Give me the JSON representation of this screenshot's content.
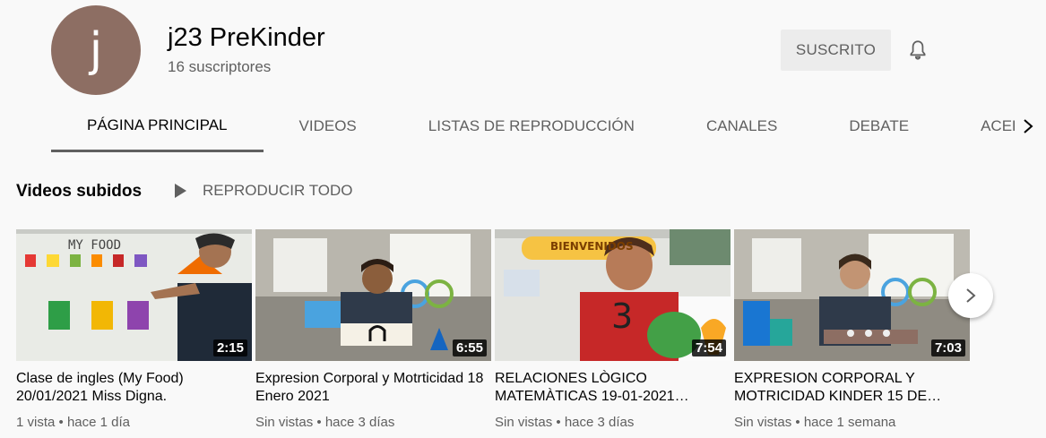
{
  "channel": {
    "avatar_letter": "j",
    "avatar_color": "#8d6e63",
    "name": "j23 PreKinder",
    "subscribers": "16 suscriptores",
    "subscribe_label": "SUSCRITO"
  },
  "tabs": [
    {
      "label": "PÁGINA PRINCIPAL",
      "active": true
    },
    {
      "label": "VIDEOS"
    },
    {
      "label": "LISTAS DE REPRODUCCIÓN"
    },
    {
      "label": "CANALES"
    },
    {
      "label": "DEBATE"
    },
    {
      "label": "ACERCA DE"
    }
  ],
  "section": {
    "title": "Videos subidos",
    "play_all_label": "REPRODUCIR TODO"
  },
  "videos": [
    {
      "title": "Clase de ingles (My Food) 20/01/2021 Miss Digna.",
      "duration": "2:15",
      "views": "1 vista",
      "age": "hace 1 día",
      "thumb_text": "MY FOOD"
    },
    {
      "title": "Expresion Corporal y Motrticidad 18 Enero 2021",
      "duration": "6:55",
      "views": "Sin vistas",
      "age": "hace 3 días"
    },
    {
      "title": "RELACIONES LÒGICO MATEMÀTICAS 19-01-2021…",
      "duration": "7:54",
      "views": "Sin vistas",
      "age": "hace 3 días",
      "thumb_text": "BIENVENIDOS"
    },
    {
      "title": "EXPRESION CORPORAL Y MOTRICIDAD KINDER 15 DE…",
      "duration": "7:03",
      "views": "Sin vistas",
      "age": "hace 1 semana"
    }
  ],
  "meta_separator": "•",
  "icons": {
    "bell": "bell-icon",
    "tabs_scroll": "chevron-right-icon",
    "play": "play-icon",
    "carousel_next": "chevron-right-icon"
  }
}
